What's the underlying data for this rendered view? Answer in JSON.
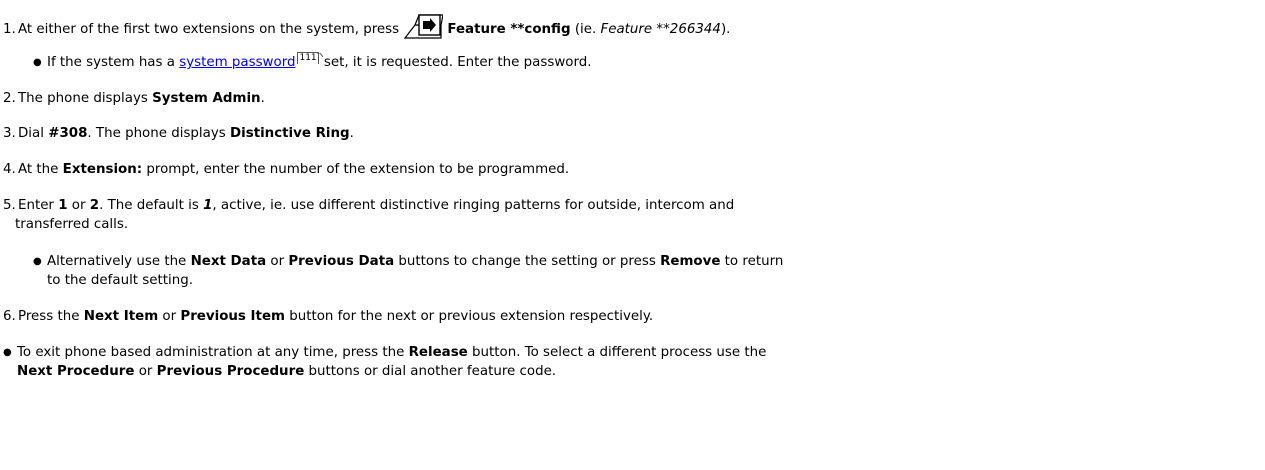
{
  "steps": [
    {
      "num": "1.",
      "prefix": "At either of the first two extensions on the system, press ",
      "bold": "Feature **config",
      "mid": " (ie. ",
      "italic": "Feature **266344",
      "suffix": ")."
    },
    {
      "num": "2.",
      "prefix": "The phone displays ",
      "bold": "System Admin",
      "suffix": "."
    },
    {
      "num": "3.",
      "prefix": "Dial ",
      "bold1": "#308",
      "mid": ". The phone displays ",
      "bold2": "Distinctive Ring",
      "suffix": "."
    },
    {
      "num": "4.",
      "prefix": "At the ",
      "bold": "Extension:",
      "suffix": " prompt, enter the number of the extension to be programmed."
    },
    {
      "num": "5.",
      "prefix": "Enter ",
      "bold1": "1",
      "mid1": " or ",
      "bold2": "2",
      "mid2": ". The default is ",
      "bolditalic": "1",
      "suffix_line1": ", active, ie. use different distinctive ringing patterns for outside, intercom and",
      "suffix_line2": "transferred calls."
    },
    {
      "num": "6.",
      "prefix": "Press the ",
      "bold1": "Next Item",
      "mid": " or ",
      "bold2": "Previous Item",
      "suffix": " button for the next or previous extension respectively."
    }
  ],
  "sub1": {
    "bullet": "●",
    "prefix": "If the system has a ",
    "link": "system password",
    "ref": "111",
    "suffix": " set, it is requested. Enter the password."
  },
  "sub5": {
    "bullet": "●",
    "prefix": "Alternatively use the ",
    "bold1": "Next Data",
    "mid1": " or ",
    "bold2": "Previous Data",
    "mid2": " buttons to change the setting or press ",
    "bold3": "Remove",
    "suffix_line1": " to return",
    "suffix_line2": "to the default setting."
  },
  "tip": {
    "bullet": "●",
    "prefix": "To exit phone based administration at any time, press the ",
    "bold1": "Release",
    "mid1": " button. To select a different process use the",
    "bold2": "Next Procedure",
    "mid2": " or ",
    "bold3": "Previous Procedure",
    "suffix": " buttons or dial another feature code."
  },
  "icons": {
    "feature_button": "feature-button-icon",
    "ref_marker": "popup-reference-icon"
  }
}
